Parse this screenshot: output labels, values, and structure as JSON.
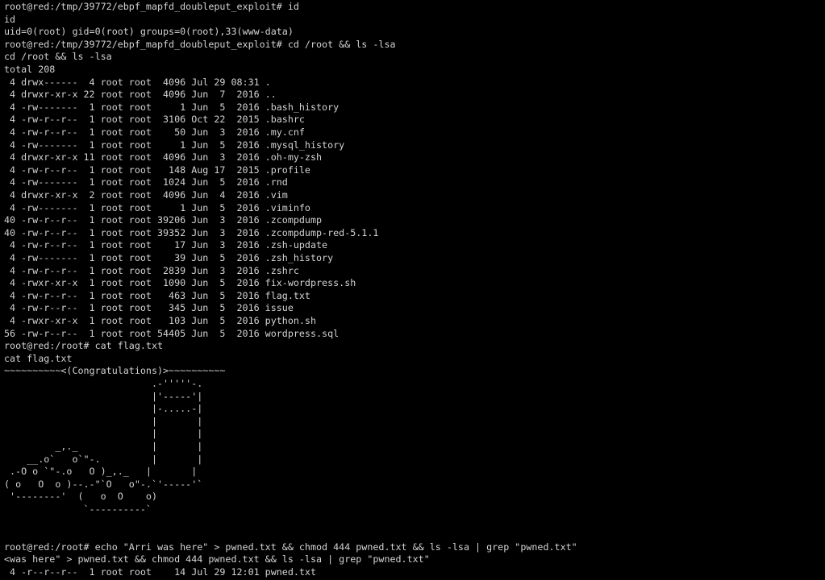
{
  "colors": {
    "background": "#000000",
    "text": "#d3d3d3"
  },
  "terminal": {
    "lines": [
      "root@red:/tmp/39772/ebpf_mapfd_doubleput_exploit# id",
      "id",
      "uid=0(root) gid=0(root) groups=0(root),33(www-data)",
      "root@red:/tmp/39772/ebpf_mapfd_doubleput_exploit# cd /root && ls -lsa",
      "cd /root && ls -lsa",
      "total 208",
      " 4 drwx------  4 root root  4096 Jul 29 08:31 .",
      " 4 drwxr-xr-x 22 root root  4096 Jun  7  2016 ..",
      " 4 -rw-------  1 root root     1 Jun  5  2016 .bash_history",
      " 4 -rw-r--r--  1 root root  3106 Oct 22  2015 .bashrc",
      " 4 -rw-r--r--  1 root root    50 Jun  3  2016 .my.cnf",
      " 4 -rw-------  1 root root     1 Jun  5  2016 .mysql_history",
      " 4 drwxr-xr-x 11 root root  4096 Jun  3  2016 .oh-my-zsh",
      " 4 -rw-r--r--  1 root root   148 Aug 17  2015 .profile",
      " 4 -rw-------  1 root root  1024 Jun  5  2016 .rnd",
      " 4 drwxr-xr-x  2 root root  4096 Jun  4  2016 .vim",
      " 4 -rw-------  1 root root     1 Jun  5  2016 .viminfo",
      "40 -rw-r--r--  1 root root 39206 Jun  3  2016 .zcompdump",
      "40 -rw-r--r--  1 root root 39352 Jun  3  2016 .zcompdump-red-5.1.1",
      " 4 -rw-r--r--  1 root root    17 Jun  3  2016 .zsh-update",
      " 4 -rw-------  1 root root    39 Jun  5  2016 .zsh_history",
      " 4 -rw-r--r--  1 root root  2839 Jun  3  2016 .zshrc",
      " 4 -rwxr-xr-x  1 root root  1090 Jun  5  2016 fix-wordpress.sh",
      " 4 -rw-r--r--  1 root root   463 Jun  5  2016 flag.txt",
      " 4 -rw-r--r--  1 root root   345 Jun  5  2016 issue",
      " 4 -rwxr-xr-x  1 root root   103 Jun  5  2016 python.sh",
      "56 -rw-r--r--  1 root root 54405 Jun  5  2016 wordpress.sql",
      "root@red:/root# cat flag.txt",
      "cat flag.txt",
      "~~~~~~~~~~<(Congratulations)>~~~~~~~~~~",
      "                          .-'''''-.",
      "                          |'-----'|",
      "                          |-.....-|",
      "                          |       |",
      "                          |       |",
      "         _,._             |       |",
      "    __.o`   o`\"-.         |       |",
      " .-O o `\"-.o   O )_,._   |       |",
      "( o   O  o )--.-\"`O   o\"-.`'-----'`",
      " '--------'  (   o  O    o)",
      "              `----------`",
      "",
      "",
      "root@red:/root# echo \"Arri was here\" > pwned.txt && chmod 444 pwned.txt && ls -lsa | grep \"pwned.txt\"",
      "<was here\" > pwned.txt && chmod 444 pwned.txt && ls -lsa | grep \"pwned.txt\"",
      " 4 -r--r--r--  1 root root    14 Jul 29 12:01 pwned.txt"
    ]
  }
}
